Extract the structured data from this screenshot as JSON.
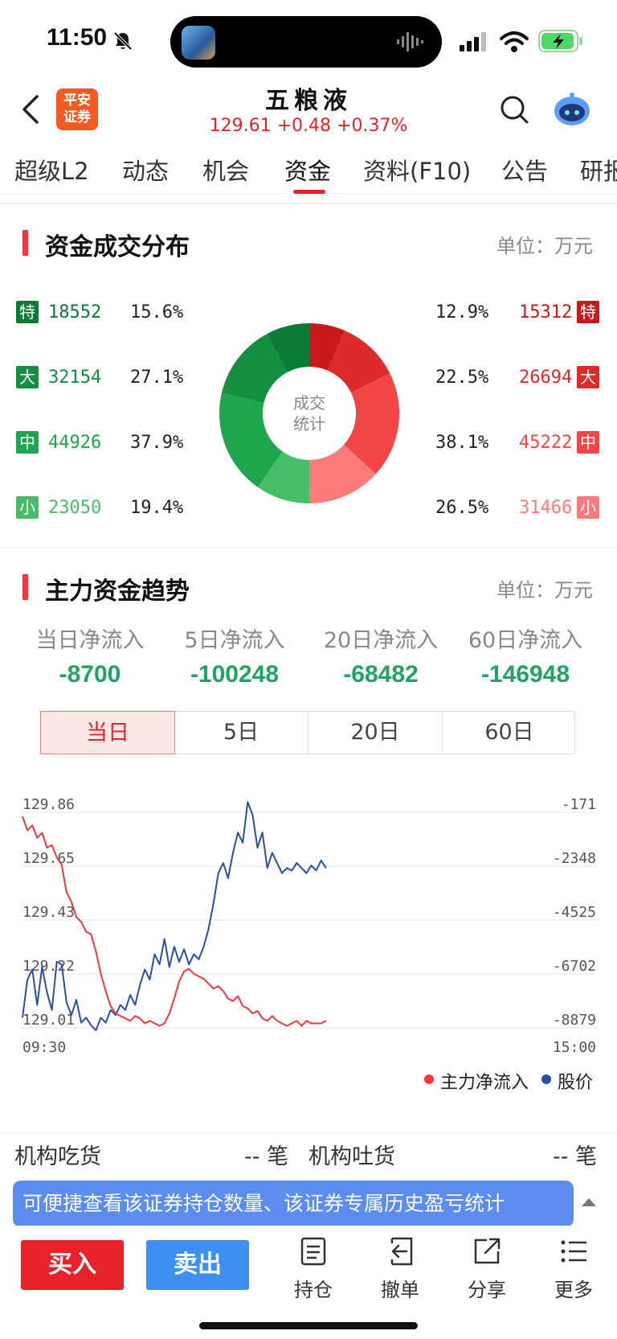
{
  "status_bar": {
    "time": "11:50"
  },
  "header": {
    "logo_line1": "平安",
    "logo_line2": "证券",
    "stock_name": "五粮液",
    "price_line": "129.61 +0.48 +0.37%"
  },
  "tabs": [
    {
      "label": "超级L2"
    },
    {
      "label": "动态"
    },
    {
      "label": "机会"
    },
    {
      "label": "资金",
      "active": true
    },
    {
      "label": "资料(F10)"
    },
    {
      "label": "公告"
    },
    {
      "label": "研报"
    }
  ],
  "distribution": {
    "title": "资金成交分布",
    "unit": "单位：万元",
    "center_line1": "成交",
    "center_line2": "统计",
    "outflow": [
      {
        "badge": "特",
        "value": "18552",
        "pct": "15.6%",
        "color": "#0a7a35"
      },
      {
        "badge": "大",
        "value": "32154",
        "pct": "27.1%",
        "color": "#138f3f"
      },
      {
        "badge": "中",
        "value": "44926",
        "pct": "37.9%",
        "color": "#1fa64c"
      },
      {
        "badge": "小",
        "value": "23050",
        "pct": "19.4%",
        "color": "#46bd67"
      }
    ],
    "inflow": [
      {
        "badge": "特",
        "value": "15312",
        "pct": "12.9%",
        "color": "#c81a1a"
      },
      {
        "badge": "大",
        "value": "26694",
        "pct": "22.5%",
        "color": "#e02a2a"
      },
      {
        "badge": "中",
        "value": "45222",
        "pct": "38.1%",
        "color": "#f24646"
      },
      {
        "badge": "小",
        "value": "31466",
        "pct": "26.5%",
        "color": "#ff7a7a"
      }
    ]
  },
  "trend": {
    "title": "主力资金趋势",
    "unit": "单位：万元",
    "net_flows": [
      {
        "label": "当日净流入",
        "value": "-8700"
      },
      {
        "label": "5日净流入",
        "value": "-100248"
      },
      {
        "label": "20日净流入",
        "value": "-68482"
      },
      {
        "label": "60日净流入",
        "value": "-146948"
      }
    ],
    "segments": [
      {
        "label": "当日",
        "active": true
      },
      {
        "label": "5日"
      },
      {
        "label": "20日"
      },
      {
        "label": "60日"
      }
    ],
    "legend": {
      "series1": "主力净流入",
      "series2": "股价"
    }
  },
  "chart_data": {
    "type": "line",
    "x_labels": [
      "09:30",
      "15:00"
    ],
    "left_ticks": [
      "129.86",
      "129.65",
      "129.43",
      "129.22",
      "129.01"
    ],
    "right_ticks": [
      "-171",
      "-2348",
      "-4525",
      "-6702",
      "-8879"
    ],
    "series": [
      {
        "name": "主力净流入",
        "color": "#f0383d",
        "values": [
          -340,
          -900,
          -700,
          -1200,
          -1000,
          -1600,
          -1500,
          -2000,
          -2300,
          -3400,
          -3800,
          -4400,
          -4600,
          -5000,
          -5100,
          -5800,
          -6700,
          -7400,
          -8000,
          -8300,
          -8400,
          -8500,
          -8600,
          -8400,
          -8500,
          -8700,
          -8600,
          -8700,
          -8800,
          -8700,
          -8300,
          -7700,
          -7000,
          -6600,
          -6500,
          -6700,
          -6800,
          -6900,
          -7100,
          -7300,
          -7200,
          -7400,
          -7700,
          -7800,
          -7600,
          -8000,
          -8100,
          -8300,
          -8200,
          -8500,
          -8600,
          -8400,
          -8600,
          -8700,
          -8800,
          -8700,
          -8600,
          -8800,
          -8600,
          -8700,
          -8700,
          -8700,
          -8600
        ]
      },
      {
        "name": "股价",
        "color": "#2a4fa0",
        "values": [
          129.05,
          129.2,
          129.24,
          129.1,
          129.25,
          129.15,
          129.08,
          129.27,
          129.26,
          129.11,
          129.06,
          129.12,
          129.03,
          129.05,
          129.02,
          129.0,
          129.05,
          129.03,
          129.08,
          129.06,
          129.1,
          129.08,
          129.14,
          129.1,
          129.18,
          129.24,
          129.2,
          129.3,
          129.26,
          129.36,
          129.25,
          129.33,
          129.27,
          129.32,
          129.26,
          129.3,
          129.28,
          129.33,
          129.4,
          129.5,
          129.62,
          129.66,
          129.6,
          129.7,
          129.78,
          129.74,
          129.9,
          129.85,
          129.72,
          129.78,
          129.64,
          129.7,
          129.66,
          129.62,
          129.64,
          129.63,
          129.66,
          129.64,
          129.62,
          129.65,
          129.63,
          129.67,
          129.64
        ]
      }
    ]
  },
  "institution": {
    "eat_label": "机构吃货",
    "eat_value": "-- 笔",
    "spit_label": "机构吐货",
    "spit_value": "-- 笔"
  },
  "toast": {
    "text": "可便捷查看该证券持仓数量、该证券专属历史盈亏统计"
  },
  "toolbar": {
    "buy": "买入",
    "sell": "卖出",
    "holdings": "持仓",
    "cancel": "撤单",
    "share": "分享",
    "more": "更多"
  }
}
